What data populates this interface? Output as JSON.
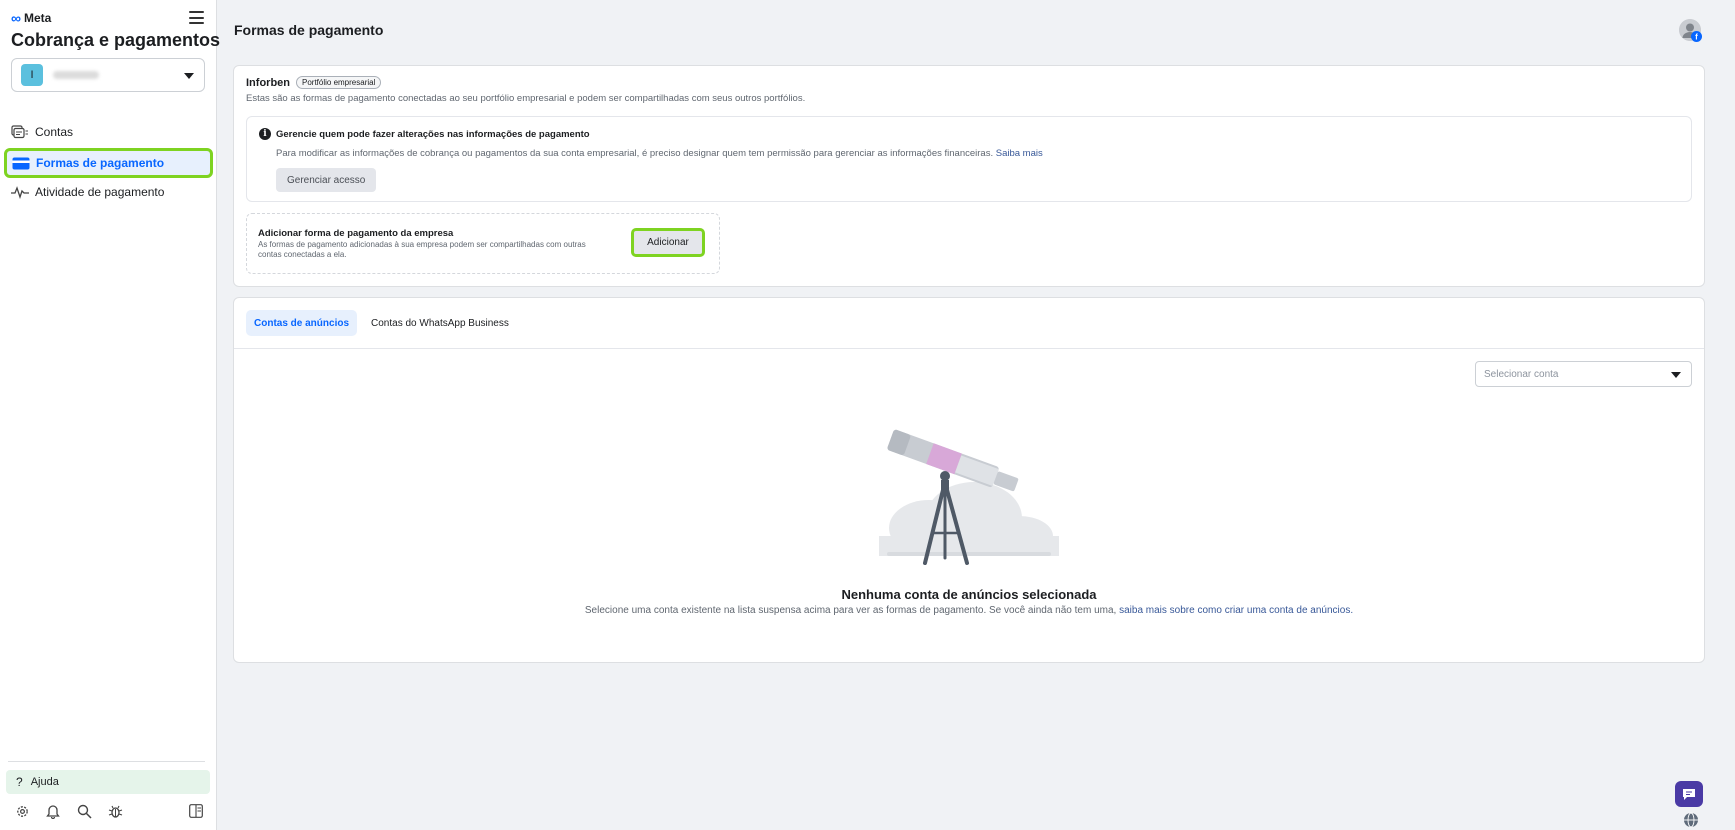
{
  "sidebar": {
    "brand": "Meta",
    "title": "Cobrança e pagamentos",
    "account_initial": "I",
    "nav": [
      {
        "label": "Contas"
      },
      {
        "label": "Formas de pagamento"
      },
      {
        "label": "Atividade de pagamento"
      }
    ],
    "help_label": "Ajuda"
  },
  "header": {
    "title": "Formas de pagamento"
  },
  "business": {
    "name": "Inforben",
    "tag": "Portfólio empresarial",
    "description": "Estas são as formas de pagamento conectadas ao seu portfólio empresarial e podem ser compartilhadas com seus outros portfólios."
  },
  "info": {
    "title": "Gerencie quem pode fazer alterações nas informações de pagamento",
    "description": "Para modificar as informações de cobrança ou pagamentos da sua conta empresarial, é preciso designar quem tem permissão para gerenciar as informações financeiras.",
    "link": "Saiba mais",
    "button": "Gerenciar acesso"
  },
  "add": {
    "title": "Adicionar forma de pagamento da empresa",
    "description": "As formas de pagamento adicionadas à sua empresa podem ser compartilhadas com outras contas conectadas a ela.",
    "button": "Adicionar"
  },
  "tabs": [
    {
      "label": "Contas de anúncios"
    },
    {
      "label": "Contas do WhatsApp Business"
    }
  ],
  "select": {
    "placeholder": "Selecionar conta"
  },
  "empty": {
    "title": "Nenhuma conta de anúncios selecionada",
    "description": "Selecione uma conta existente na lista suspensa acima para ver as formas de pagamento. Se você ainda não tem uma,",
    "link": "saiba mais sobre como criar uma conta de anúncios."
  },
  "colors": {
    "accent": "#0866ff",
    "highlight": "#7ed321",
    "link": "#385898",
    "chat": "#4a3aa5"
  }
}
